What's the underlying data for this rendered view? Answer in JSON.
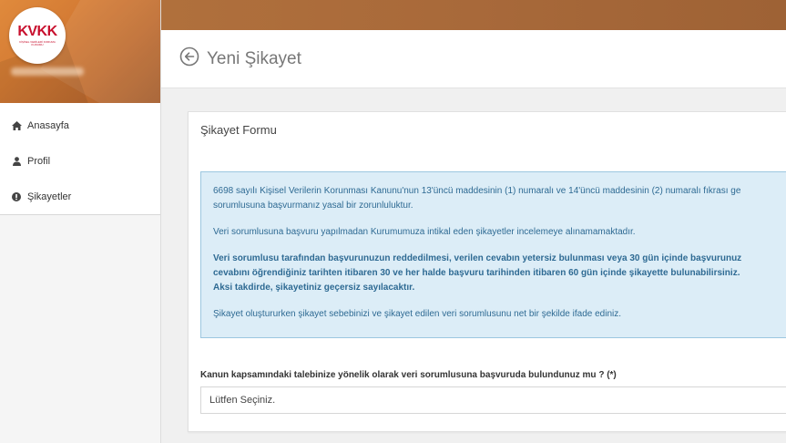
{
  "brand": {
    "logo_text": "KVKK",
    "logo_subtitle": "KİŞİSEL VERİLERİ KORUMA KURUMU"
  },
  "sidebar": {
    "items": [
      {
        "label": "Anasayfa",
        "icon": "home-icon"
      },
      {
        "label": "Profil",
        "icon": "user-icon"
      },
      {
        "label": "Şikayetler",
        "icon": "exclamation-circle-icon"
      }
    ]
  },
  "header": {
    "title": "Yeni Şikayet",
    "back_icon": "arrow-left-circle-icon"
  },
  "form": {
    "title": "Şikayet Formu",
    "info": {
      "p1_line1": "6698 sayılı Kişisel Verilerin Korunması Kanunu'nun 13'üncü maddesinin (1) numaralı ve 14'üncü maddesinin (2) numaralı fıkrası ge",
      "p1_line2": "sorumlusuna başvurmanız yasal bir zorunluluktur.",
      "p2": "Veri sorumlusuna başvuru yapılmadan Kurumumuza intikal eden şikayetler incelemeye alınamamaktadır.",
      "p3_line1": "Veri sorumlusu tarafından başvurunuzun reddedilmesi, verilen cevabın yetersiz bulunması veya 30 gün içinde başvurunuz",
      "p3_line2": "cevabını öğrendiğiniz tarihten itibaren 30 ve her halde başvuru tarihinden itibaren 60 gün içinde şikayette bulunabilirsiniz.",
      "p3_line3": "Aksi takdirde, şikayetiniz geçersiz sayılacaktır.",
      "p4": "Şikayet oluştururken şikayet sebebinizi ve şikayet edilen veri sorumlusunu net bir şekilde ifade ediniz."
    },
    "question_label": "Kanun kapsamındaki talebinize yönelik olarak veri sorumlusuna başvuruda bulundunuz mu ? (*)",
    "select_value": "Lütfen Seçiniz."
  },
  "colors": {
    "topbar": "#a8693a",
    "alert_bg": "#dcedf7",
    "alert_text": "#2e6a93",
    "logo_red": "#c8102e"
  }
}
